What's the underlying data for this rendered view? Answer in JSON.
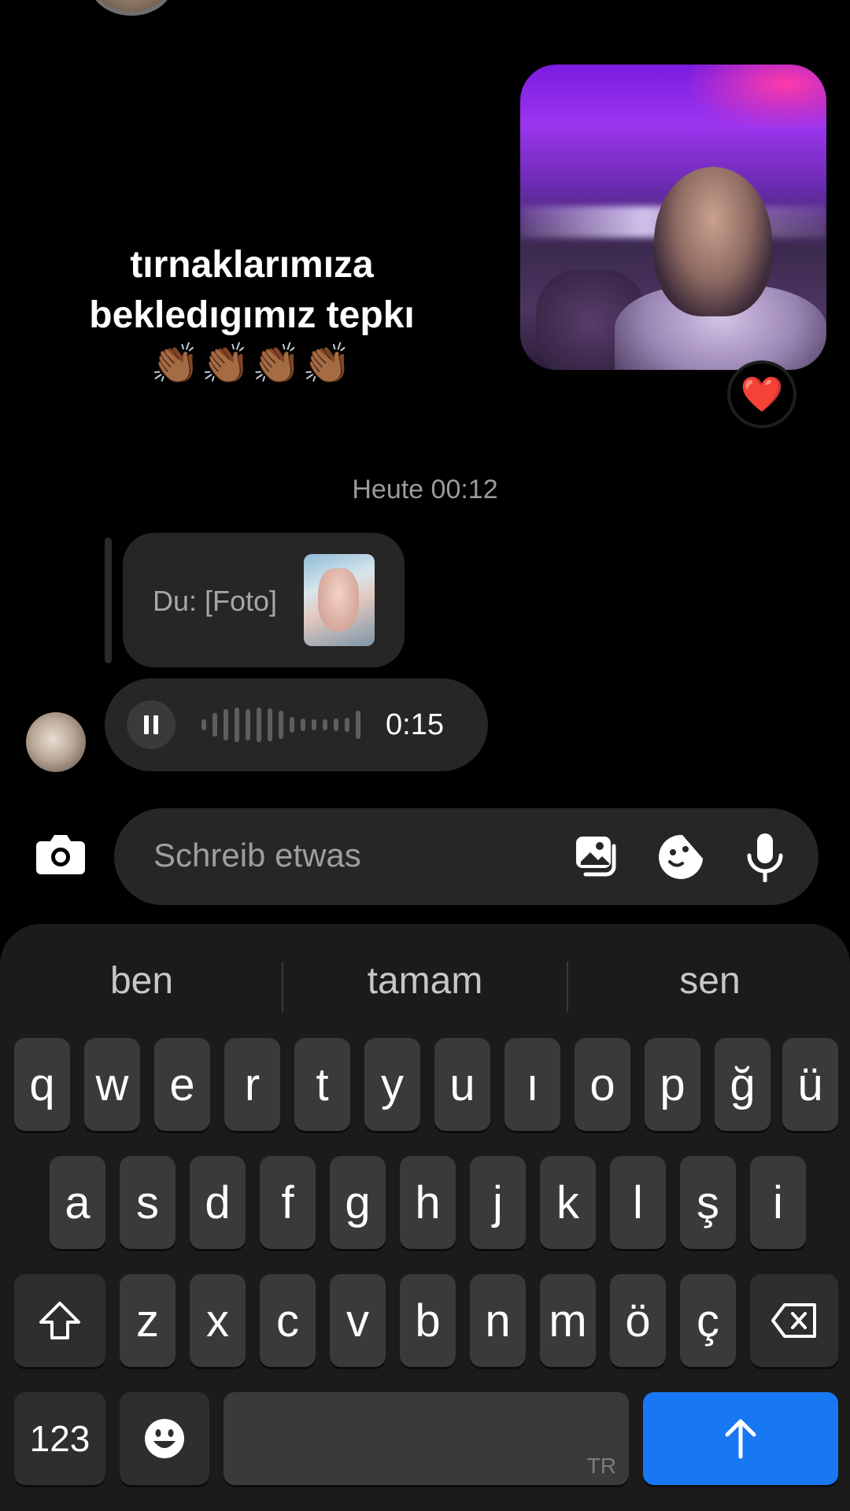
{
  "overlay": {
    "caption_line1": "tırnaklarımıza",
    "caption_line2": "bekledıgımız tepkı",
    "emoji": "👏🏾👏🏾👏🏾👏🏾"
  },
  "video_message": {
    "reaction": "❤️"
  },
  "timestamp": "Heute 00:12",
  "reply": {
    "text": "Du: [Foto]"
  },
  "voice_message": {
    "duration": "0:15",
    "state": "playing"
  },
  "composer": {
    "placeholder": "Schreib etwas"
  },
  "keyboard": {
    "suggestions": [
      "ben",
      "tamam",
      "sen"
    ],
    "row1": [
      "q",
      "w",
      "e",
      "r",
      "t",
      "y",
      "u",
      "ı",
      "o",
      "p",
      "ğ",
      "ü"
    ],
    "row2": [
      "a",
      "s",
      "d",
      "f",
      "g",
      "h",
      "j",
      "k",
      "l",
      "ş",
      "i"
    ],
    "row3": [
      "z",
      "x",
      "c",
      "v",
      "b",
      "n",
      "m",
      "ö",
      "ç"
    ],
    "numbers_label": "123",
    "language_label": "TR"
  },
  "colors": {
    "send_key": "#1877f2",
    "heart": "#e8112d",
    "bubble": "#262626"
  },
  "icons": [
    "camera-icon",
    "gallery-icon",
    "sticker-icon",
    "microphone-icon",
    "pause-icon",
    "shift-icon",
    "backspace-icon",
    "emoji-icon",
    "send-arrow-icon"
  ]
}
